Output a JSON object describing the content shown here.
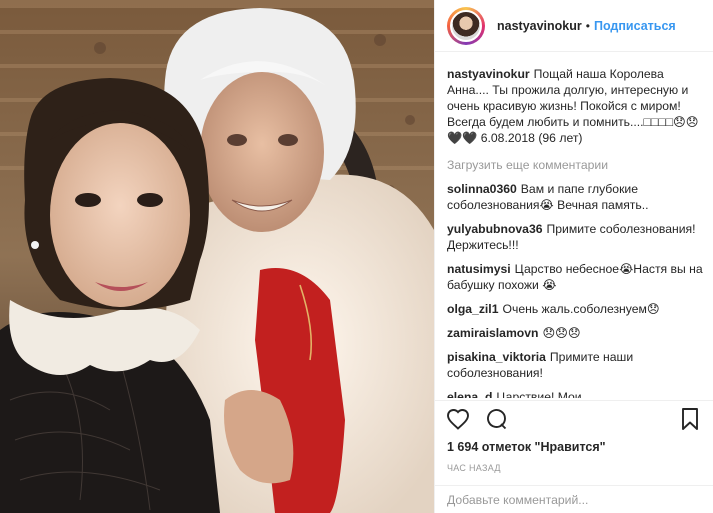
{
  "post": {
    "username": "nastyavinokur",
    "separator": "•",
    "follow_label": "Подписаться"
  },
  "caption": {
    "username": "nastyavinokur",
    "text": "Пощай наша Королева Анна.... Ты прожила долгую, интересную и очень красивую жизнь! Покойся с миром! Всегда будем любить и помнить....□□□□😞😞🖤🖤 6.08.2018 (96 лет)"
  },
  "load_more": "Загрузить еще комментарии",
  "comments": [
    {
      "user": "solinna0360",
      "text": "Вам и папе глубокие соболезнования😭 Вечная память.."
    },
    {
      "user": "yulyabubnova36",
      "text": "Примите соболезнования!Держитесь!!!"
    },
    {
      "user": "natusimysi",
      "text": "Царство небесное😭Настя вы на бабушку похожи 😭"
    },
    {
      "user": "olga_zil1",
      "text": "Очень жаль.соболезнуем😞"
    },
    {
      "user": "zamiraislamovn",
      "text": "😞😞😞"
    },
    {
      "user": "pisakina_viktoria",
      "text": "Примите наши соболезнования!"
    },
    {
      "user": "elena_d",
      "text": "Царствие! Мои"
    }
  ],
  "likes": "1 694 отметок \"Нравится\"",
  "time": "ЧАС НАЗАД",
  "add_comment_placeholder": "Добавьте комментарий...",
  "icons": {
    "like": "heart-icon",
    "comment": "comment-bubble-icon",
    "save": "bookmark-icon"
  }
}
